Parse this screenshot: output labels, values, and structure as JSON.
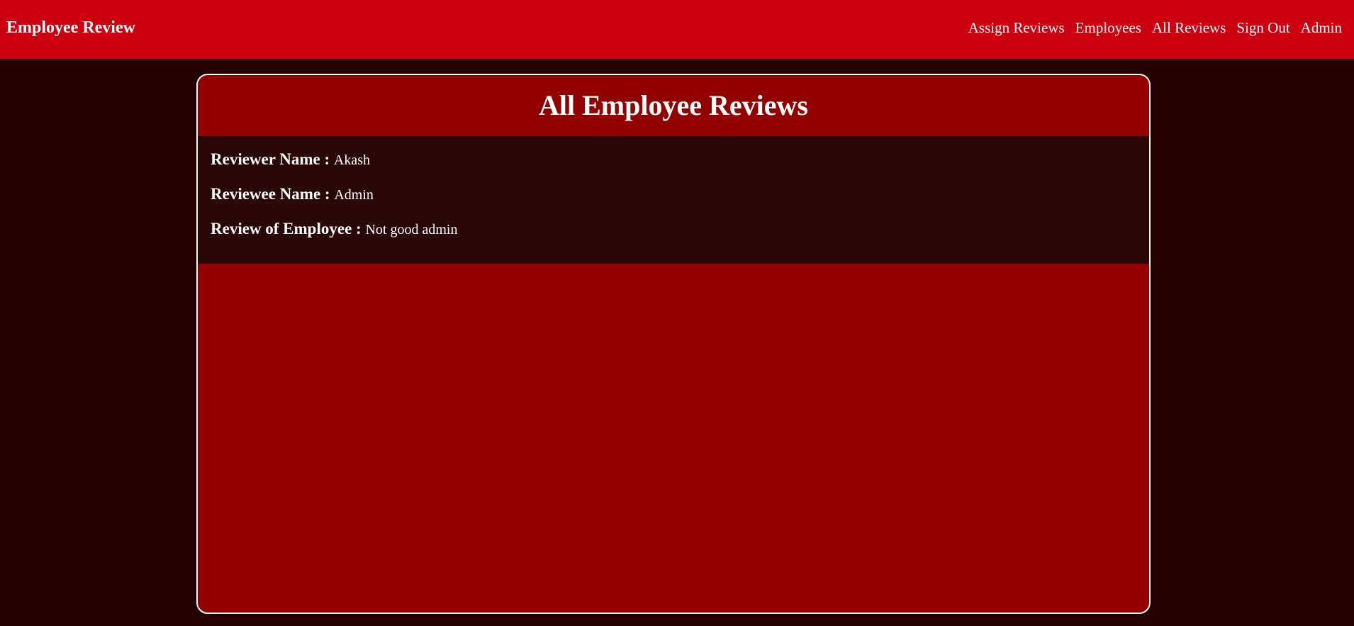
{
  "navbar": {
    "brand": "Employee Review",
    "links": [
      "Assign Reviews",
      "Employees",
      "All Reviews",
      "Sign Out",
      "Admin"
    ]
  },
  "main": {
    "title": "All Employee Reviews",
    "reviews": [
      {
        "reviewer_label": "Reviewer Name :",
        "reviewer": "Akash",
        "reviewee_label": "Reviewee Name :",
        "reviewee": "Admin",
        "review_label": "Review of Employee :",
        "review": "Not good admin"
      }
    ]
  },
  "colors": {
    "navbar_bg": "#cc0011",
    "page_bg": "#240000",
    "card_bg": "#930000",
    "review_bg": "#2b0808"
  }
}
